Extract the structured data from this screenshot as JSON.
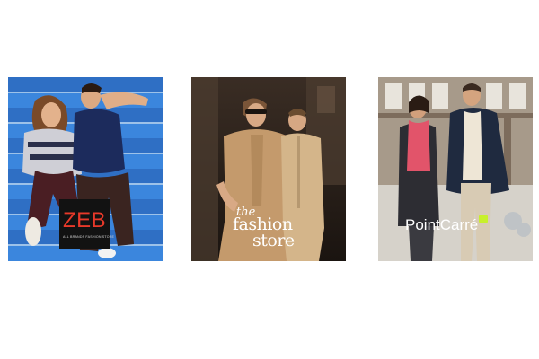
{
  "brands": [
    {
      "id": "zeb",
      "name": "ZEB",
      "tagline": "ALL BRANDS FASHION STORE",
      "accent": "#e8392a"
    },
    {
      "id": "fashion",
      "name_line1": "the",
      "name_line2": "fashion",
      "name_line3": "store",
      "accent": "#ffffff"
    },
    {
      "id": "point",
      "name": "PointCarré",
      "accent": "#c8f02a"
    }
  ],
  "icons": {
    "brand_mark": "lime-square-icon"
  }
}
